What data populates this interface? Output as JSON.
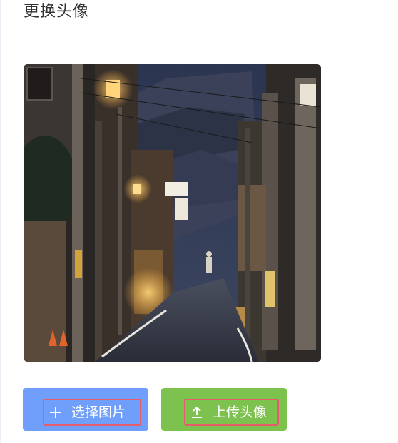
{
  "dialog": {
    "title": "更换头像"
  },
  "cropper": {
    "image_description_icon": "street-photo"
  },
  "buttons": {
    "select_label": "选择图片",
    "select_icon": "plus-icon",
    "upload_label": "上传头像",
    "upload_icon": "upload-icon"
  },
  "colors": {
    "select_button": "#6f9ffb",
    "upload_button": "#7dc14f",
    "highlight_border": "#e85b6b"
  }
}
